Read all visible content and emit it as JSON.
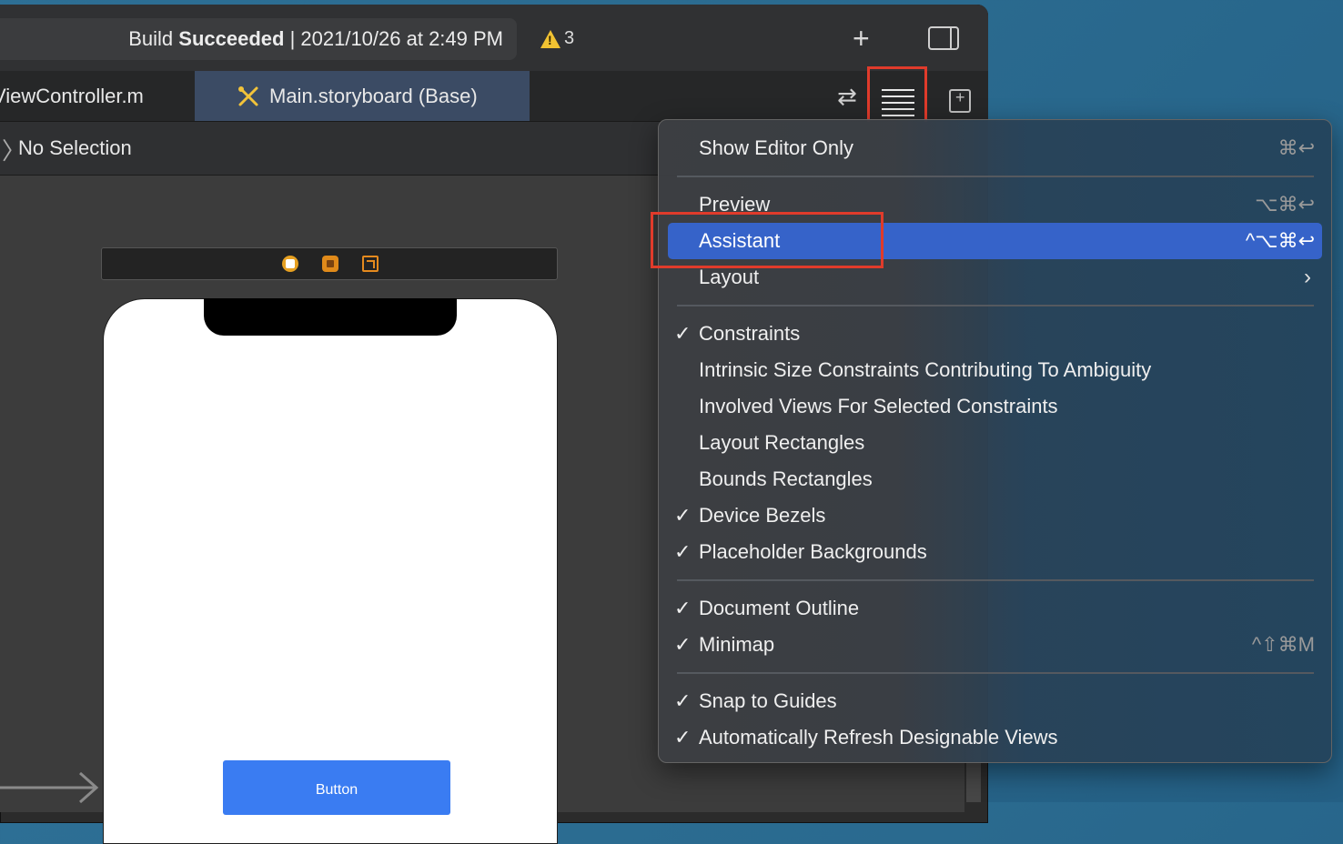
{
  "toolbar": {
    "status_prefix": "Build",
    "status_bold": "Succeeded",
    "status_suffix": "| 2021/10/26 at 2:49 PM",
    "warning_count": "3",
    "add_icon": "plus-icon",
    "inspector_icon": "inspector-toggle-icon"
  },
  "tabs": [
    {
      "label": "ViewController.m"
    },
    {
      "label": "Main.storyboard (Base)",
      "icon": "storyboard-icon"
    }
  ],
  "jumpbar": {
    "text": "No Selection"
  },
  "canvas": {
    "button_label": "Button"
  },
  "menu": {
    "items": [
      {
        "label": "Show Editor Only",
        "shortcut": "⌘↩",
        "checked": false
      },
      {
        "label": "Preview",
        "shortcut": "⌥⌘↩",
        "checked": false
      },
      {
        "label": "Assistant",
        "shortcut": "^⌥⌘↩",
        "checked": false,
        "highlighted": true
      },
      {
        "label": "Layout",
        "shortcut": "",
        "checked": false,
        "submenu": true
      },
      {
        "label": "Constraints",
        "shortcut": "",
        "checked": true
      },
      {
        "label": "Intrinsic Size Constraints Contributing To Ambiguity",
        "shortcut": "",
        "checked": false
      },
      {
        "label": "Involved Views For Selected Constraints",
        "shortcut": "",
        "checked": false
      },
      {
        "label": "Layout Rectangles",
        "shortcut": "",
        "checked": false
      },
      {
        "label": "Bounds Rectangles",
        "shortcut": "",
        "checked": false
      },
      {
        "label": "Device Bezels",
        "shortcut": "",
        "checked": true
      },
      {
        "label": "Placeholder Backgrounds",
        "shortcut": "",
        "checked": true
      },
      {
        "label": "Document Outline",
        "shortcut": "",
        "checked": true
      },
      {
        "label": "Minimap",
        "shortcut": "^⇧⌘M",
        "checked": true
      },
      {
        "label": "Snap to Guides",
        "shortcut": "",
        "checked": true
      },
      {
        "label": "Automatically Refresh Designable Views",
        "shortcut": "",
        "checked": true
      }
    ],
    "check_glyph": "✓",
    "submenu_glyph": "›"
  },
  "colors": {
    "highlight": "#3663c9",
    "annotation_red": "#e03b2b",
    "button_blue": "#3a7cf2",
    "warning_yellow": "#f1c232"
  }
}
